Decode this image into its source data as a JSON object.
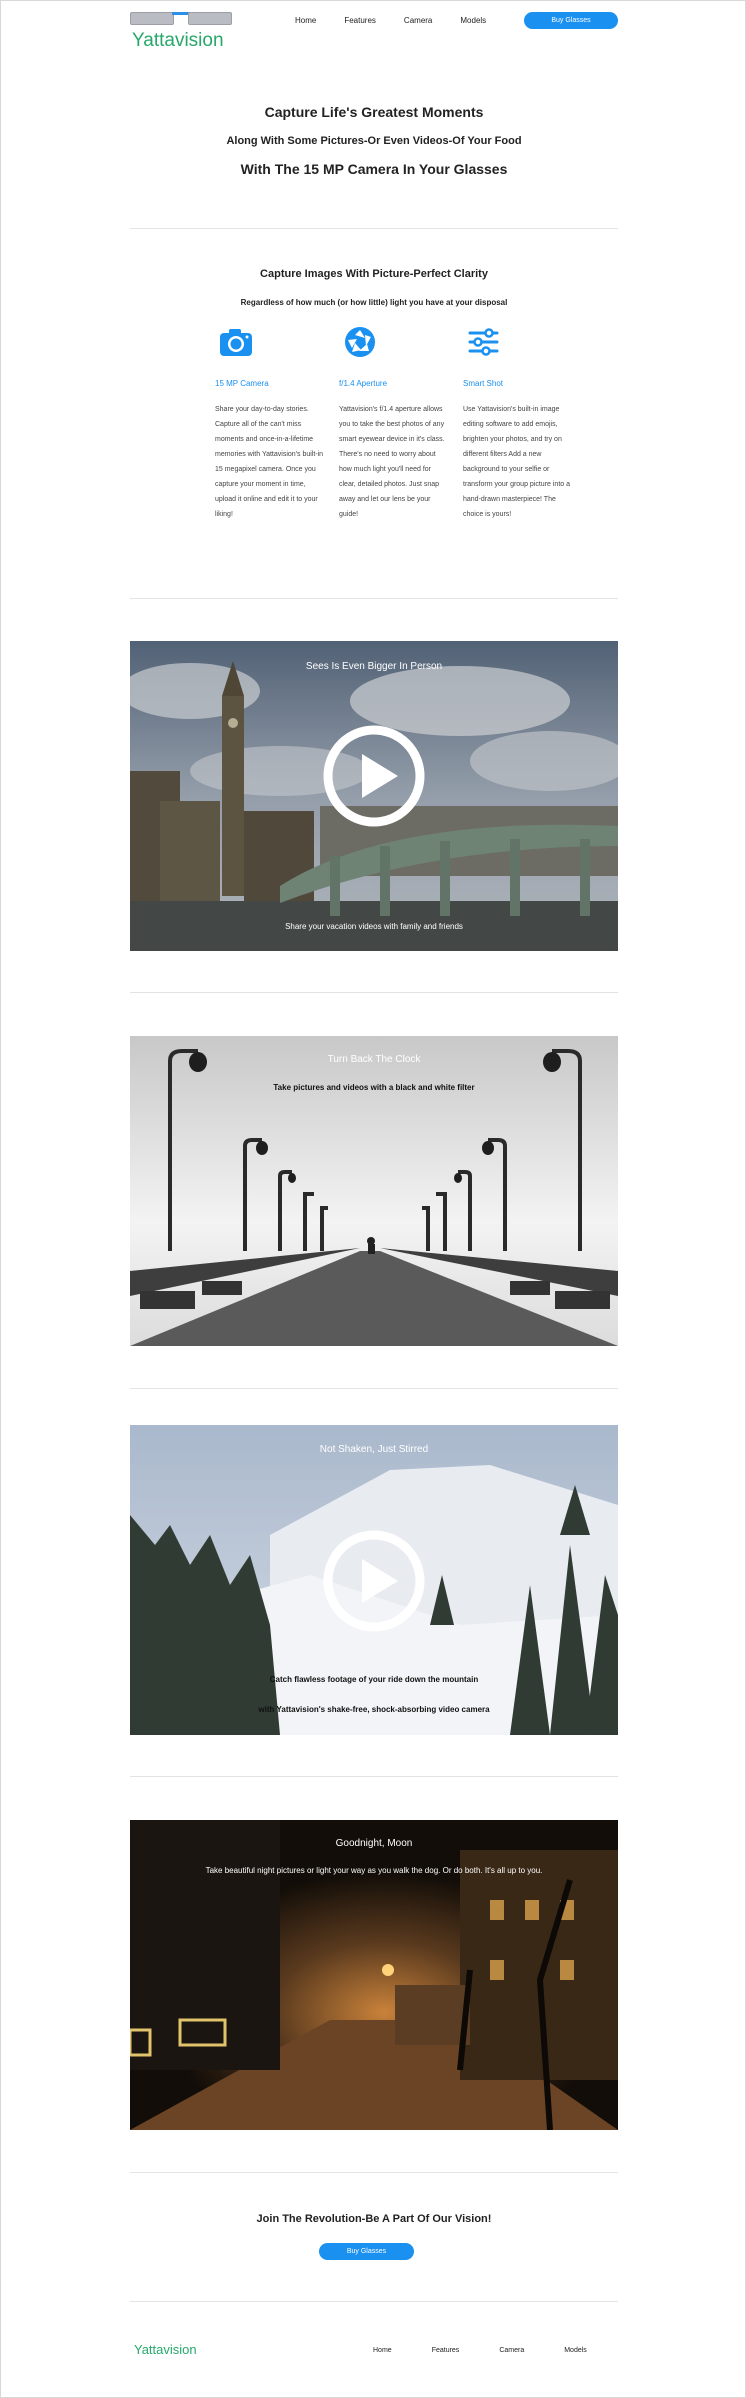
{
  "brand": {
    "name": "Yattavision",
    "accent": "#1a90f0",
    "logo_color": "#27a86a"
  },
  "nav": {
    "items": [
      "Home",
      "Features",
      "Camera",
      "Models"
    ],
    "cta_label": "Buy Glasses"
  },
  "hero": {
    "line1": "Capture Life's Greatest Moments",
    "line2": "Along With Some Pictures-Or Even Videos-Of Your Food",
    "line3": "With The 15 MP Camera In Your Glasses"
  },
  "features": {
    "title": "Capture Images With Picture-Perfect Clarity",
    "subtitle": "Regardless of how much (or how little) light you have at your disposal",
    "items": [
      {
        "icon": "camera-icon",
        "name": "15 MP Camera",
        "desc": "Share your day-to-day stories. Capture all of the can't miss moments and once-in-a-lifetime memories with Yattavision's built-in 15 megapixel camera. Once you capture your moment in time, upload it online and edit it to your liking!"
      },
      {
        "icon": "aperture-icon",
        "name": "f/1.4 Aperture",
        "desc": "Yattavision's f/1.4 aperture allows you to take the best photos of any smart eyewear device in it's class. There's no need to worry about how much light you'll need for clear, detailed photos. Just snap away and let our lens be your guide!"
      },
      {
        "icon": "sliders-icon",
        "name": "Smart Shot",
        "desc": "Use Yattavision's built-in image editing software to add emojis, brighten your photos, and try on different filters Add a new background to your selfie or transform your group picture into a hand-drawn masterpiece! The choice is yours!"
      }
    ]
  },
  "panels": [
    {
      "title": "Sees Is Even Bigger In Person",
      "text": "Share your vacation videos with family and friends",
      "play": true
    },
    {
      "title": "Turn Back The Clock",
      "text": "Take pictures and videos with a black and white filter",
      "play": false
    },
    {
      "title": "Not Shaken, Just Stirred",
      "text": "Catch flawless footage of your ride down the mountain",
      "text2": "with Yattavision's shake-free, shock-absorbing video camera",
      "play": true
    },
    {
      "title": "Goodnight, Moon",
      "text": "Take beautiful night pictures or light your way as you walk the dog. Or do both. It's all up to you.",
      "play": false
    }
  ],
  "join": {
    "title": "Join The Revolution-Be A Part Of Our Vision!",
    "button": "Buy Glasses"
  },
  "footer": {
    "logo": "Yattavision",
    "items": [
      "Home",
      "Features",
      "Camera",
      "Models"
    ]
  }
}
